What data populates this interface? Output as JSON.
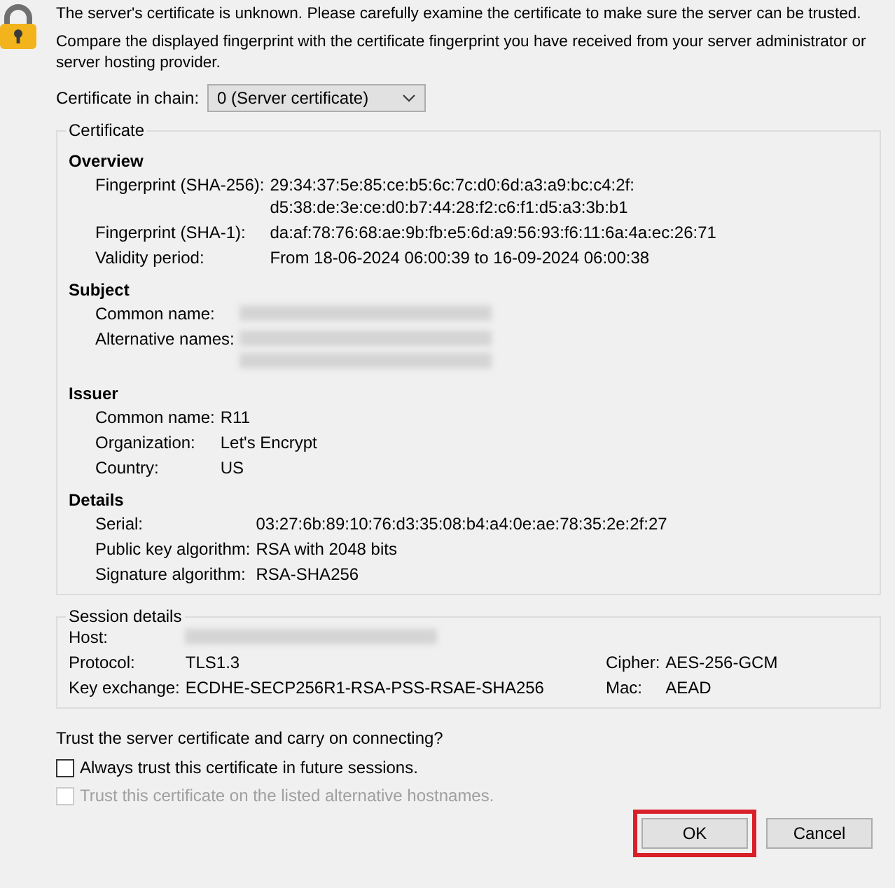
{
  "messages": [
    "The server's certificate is unknown. Please carefully examine the certificate to make sure the server can be trusted.",
    "Compare the displayed fingerprint with the certificate fingerprint you have received from your server administrator or server hosting provider."
  ],
  "chain": {
    "label": "Certificate in chain:",
    "value": "0 (Server certificate)"
  },
  "certificate": {
    "title": "Certificate",
    "sections": [
      {
        "heading": "Overview",
        "rows": [
          {
            "label": "Fingerprint (SHA-256):",
            "values": [
              {
                "kind": "text",
                "text": "29:34:37:5e:85:ce:b5:6c:7c:d0:6d:a3:a9:bc:c4:2f:"
              },
              {
                "kind": "text",
                "text": "d5:38:de:3e:ce:d0:b7:44:28:f2:c6:f1:d5:a3:3b:b1"
              }
            ]
          },
          {
            "label": "Fingerprint (SHA-1):",
            "values": [
              {
                "kind": "text",
                "text": "da:af:78:76:68:ae:9b:fb:e5:6d:a9:56:93:f6:11:6a:4a:ec:26:71"
              }
            ]
          },
          {
            "label": "Validity period:",
            "values": [
              {
                "kind": "text",
                "text": "From 18-06-2024 06:00:39 to 16-09-2024 06:00:38"
              }
            ]
          }
        ]
      },
      {
        "heading": "Subject",
        "rows": [
          {
            "label": "Common name:",
            "values": [
              {
                "kind": "blurred"
              }
            ]
          },
          {
            "label": "Alternative names:",
            "values": [
              {
                "kind": "blurred"
              },
              {
                "kind": "blurred"
              }
            ]
          }
        ]
      },
      {
        "heading": "Issuer",
        "rows": [
          {
            "label": "Common name:",
            "values": [
              {
                "kind": "text",
                "text": "R11"
              }
            ]
          },
          {
            "label": "Organization:",
            "values": [
              {
                "kind": "text",
                "text": "Let's Encrypt"
              }
            ]
          },
          {
            "label": "Country:",
            "values": [
              {
                "kind": "text",
                "text": "US"
              }
            ]
          }
        ]
      },
      {
        "heading": "Details",
        "rows": [
          {
            "label": "Serial:",
            "values": [
              {
                "kind": "text",
                "text": "03:27:6b:89:10:76:d3:35:08:b4:a4:0e:ae:78:35:2e:2f:27"
              }
            ]
          },
          {
            "label": "Public key algorithm:",
            "values": [
              {
                "kind": "text",
                "text": "RSA with 2048 bits"
              }
            ]
          },
          {
            "label": "Signature algorithm:",
            "values": [
              {
                "kind": "text",
                "text": "RSA-SHA256"
              }
            ]
          }
        ]
      }
    ]
  },
  "session": {
    "title": "Session details",
    "rows": [
      {
        "label": "Host:",
        "value": {
          "kind": "blurred"
        }
      },
      {
        "label": "Protocol:",
        "value": {
          "kind": "text",
          "text": "TLS1.3"
        },
        "side_label": "Cipher:",
        "side_value": "AES-256-GCM"
      },
      {
        "label": "Key exchange:",
        "value": {
          "kind": "text",
          "text": "ECDHE-SECP256R1-RSA-PSS-RSAE-SHA256"
        },
        "side_label": "Mac:",
        "side_value": "AEAD"
      }
    ]
  },
  "question": "Trust the server certificate and carry on connecting?",
  "options": [
    {
      "label": "Always trust this certificate in future sessions.",
      "checked": false,
      "disabled": false
    },
    {
      "label": "Trust this certificate on the listed alternative hostnames.",
      "checked": false,
      "disabled": true
    }
  ],
  "buttons": [
    {
      "label": "OK",
      "highlighted": true
    },
    {
      "label": "Cancel",
      "highlighted": false
    }
  ]
}
